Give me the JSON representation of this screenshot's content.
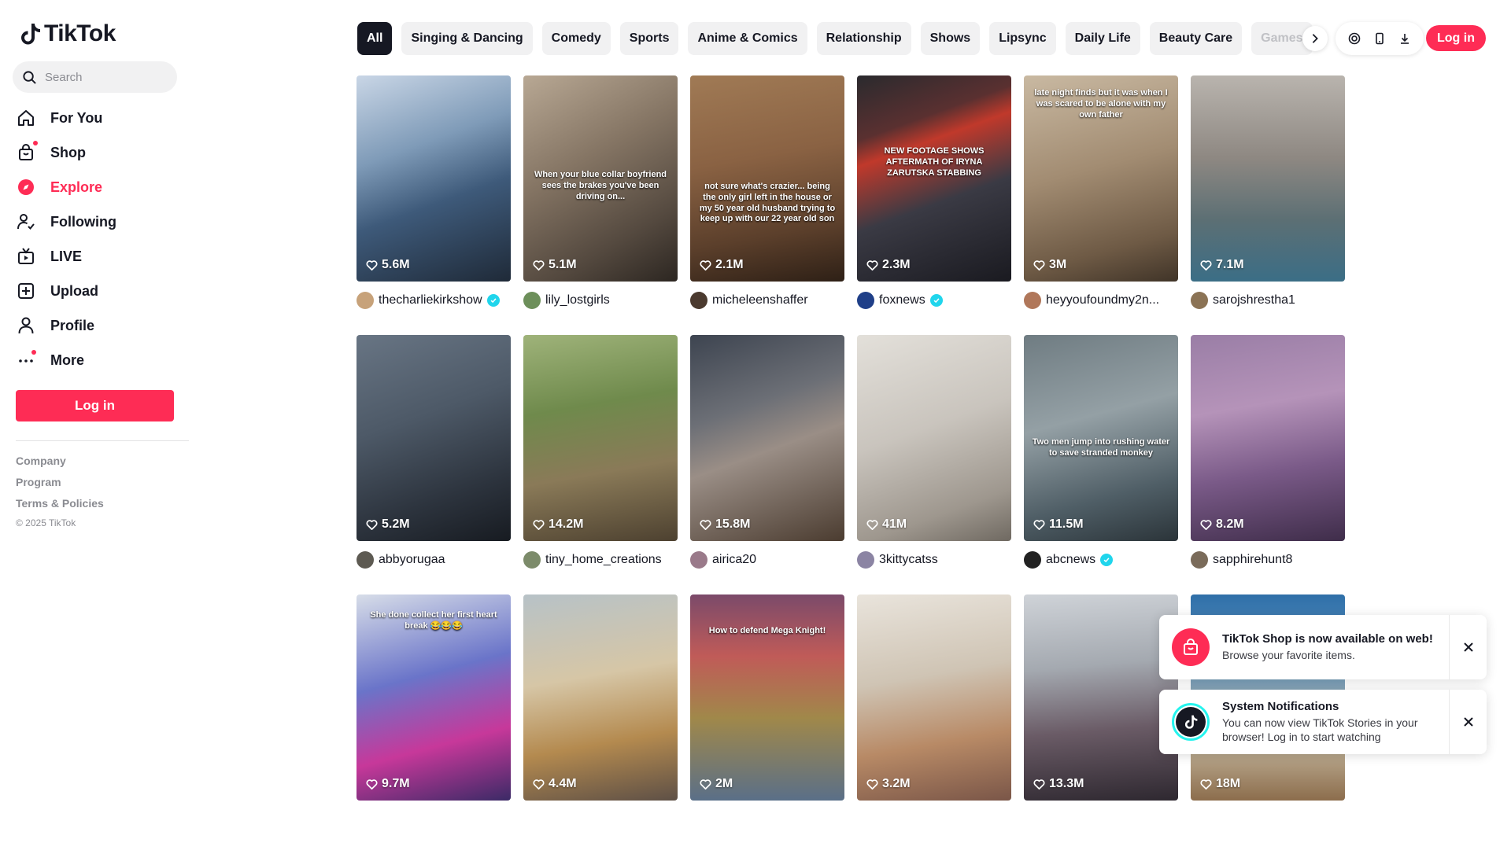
{
  "brand": {
    "name": "TikTok",
    "accent": "#fe2c55"
  },
  "search": {
    "placeholder": "Search"
  },
  "nav": [
    {
      "label": "For You",
      "icon": "home-icon"
    },
    {
      "label": "Shop",
      "icon": "shop-icon"
    },
    {
      "label": "Explore",
      "icon": "explore-icon"
    },
    {
      "label": "Following",
      "icon": "following-icon"
    },
    {
      "label": "LIVE",
      "icon": "live-icon"
    },
    {
      "label": "Upload",
      "icon": "upload-icon"
    },
    {
      "label": "Profile",
      "icon": "profile-icon"
    },
    {
      "label": "More",
      "icon": "more-icon"
    }
  ],
  "sidebar": {
    "login_label": "Log in"
  },
  "footer": {
    "links": [
      "Company",
      "Program",
      "Terms & Policies"
    ],
    "copyright": "© 2025 TikTok"
  },
  "categories": [
    "All",
    "Singing & Dancing",
    "Comedy",
    "Sports",
    "Anime & Comics",
    "Relationship",
    "Shows",
    "Lipsync",
    "Daily Life",
    "Beauty Care",
    "Games"
  ],
  "header": {
    "login_label": "Log in"
  },
  "videos": [
    {
      "likes": "5.6M",
      "author": "thecharliekirkshow",
      "verified": true,
      "caption": ""
    },
    {
      "likes": "5.1M",
      "author": "lily_lostgirls",
      "verified": false,
      "caption": "When your blue collar boyfriend sees the brakes you've been driving on..."
    },
    {
      "likes": "2.1M",
      "author": "micheleenshaffer",
      "verified": false,
      "caption": "not sure what's crazier... being the only girl left in the house or my 50 year old husband trying to keep up with our 22 year old son"
    },
    {
      "likes": "2.3M",
      "author": "foxnews",
      "verified": true,
      "caption": "NEW FOOTAGE SHOWS AFTERMATH OF IRYNA ZARUTSKA STABBING"
    },
    {
      "likes": "3M",
      "author": "heyyoufoundmy2n...",
      "verified": false,
      "caption": "late night finds but it was when I was scared to be alone with my own father"
    },
    {
      "likes": "7.1M",
      "author": "sarojshrestha1",
      "verified": false,
      "caption": ""
    },
    {
      "likes": "5.2M",
      "author": "abbyorugaa",
      "verified": false,
      "caption": ""
    },
    {
      "likes": "14.2M",
      "author": "tiny_home_creations",
      "verified": false,
      "caption": ""
    },
    {
      "likes": "15.8M",
      "author": "airica20",
      "verified": false,
      "caption": ""
    },
    {
      "likes": "41M",
      "author": "3kittycatss",
      "verified": false,
      "caption": ""
    },
    {
      "likes": "11.5M",
      "author": "abcnews",
      "verified": true,
      "caption": "Two men jump into rushing water to save stranded monkey"
    },
    {
      "likes": "8.2M",
      "author": "sapphirehunt8",
      "verified": false,
      "caption": ""
    },
    {
      "likes": "9.7M",
      "author": "",
      "verified": false,
      "caption": "She done collect her first heart break 😂😂😂"
    },
    {
      "likes": "4.4M",
      "author": "",
      "verified": false,
      "caption": ""
    },
    {
      "likes": "2M",
      "author": "",
      "verified": false,
      "caption": "How to defend Mega Knight!"
    },
    {
      "likes": "3.2M",
      "author": "",
      "verified": false,
      "caption": ""
    },
    {
      "likes": "13.3M",
      "author": "",
      "verified": false,
      "caption": ""
    },
    {
      "likes": "18M",
      "author": "",
      "verified": false,
      "caption": ""
    }
  ],
  "notifications": [
    {
      "title": "TikTok Shop is now available on web!",
      "body": "Browse your favorite items.",
      "icon": "shop-bag-icon"
    },
    {
      "title": "System Notifications",
      "body": "You can now view TikTok Stories in your browser! Log in to start watching",
      "icon": "tiktok-logo-icon"
    }
  ]
}
